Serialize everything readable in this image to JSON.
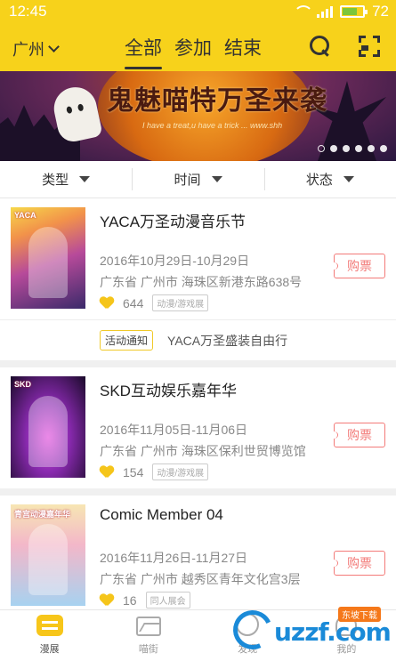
{
  "status_bar": {
    "time": "12:45",
    "battery": "72",
    "battery_level": 0.72
  },
  "header": {
    "city": "广州",
    "tabs": [
      {
        "label": "全部",
        "active": true
      },
      {
        "label": "参加",
        "active": false
      },
      {
        "label": "结束",
        "active": false
      }
    ],
    "icons": [
      "search-icon",
      "scan-icon"
    ]
  },
  "banner": {
    "title": "鬼魅喵特万圣来袭",
    "subtitle": "I have a treat,u have a trick ... www.shh",
    "slide_count": 6,
    "active_slide": 0
  },
  "filters": [
    {
      "label": "类型"
    },
    {
      "label": "时间"
    },
    {
      "label": "状态"
    }
  ],
  "events": [
    {
      "title": "YACA万圣动漫音乐节",
      "date": "2016年10月29日-10月29日",
      "address": "广东省 广州市 海珠区新港东路638号",
      "likes": "644",
      "tag": "动漫/游戏展",
      "buy_label": "购票",
      "poster_label": "YACA",
      "notice": {
        "tag": "活动通知",
        "text": "YACA万圣盛装自由行"
      }
    },
    {
      "title": "SKD互动娱乐嘉年华",
      "date": "2016年11月05日-11月06日",
      "address": "广东省 广州市 海珠区保利世贸博览馆",
      "likes": "154",
      "tag": "动漫/游戏展",
      "buy_label": "购票",
      "poster_label": "SKD"
    },
    {
      "title": "Comic Member 04",
      "date": "2016年11月26日-11月27日",
      "address": "广东省 广州市 越秀区青年文化宫3层",
      "likes": "16",
      "tag": "同人展会",
      "buy_label": "购票",
      "poster_label": "青宫动漫嘉年华"
    }
  ],
  "bottom_nav": [
    {
      "label": "漫展",
      "icon": "comic-expo-icon",
      "active": true
    },
    {
      "label": "喵街",
      "icon": "street-icon",
      "active": false
    },
    {
      "label": "发现",
      "icon": "discover-icon",
      "active": false
    },
    {
      "label": "我的",
      "icon": "profile-icon",
      "active": false
    }
  ],
  "watermark": {
    "text": "uzzf.com",
    "badge": "东坡下载"
  },
  "colors": {
    "brand_yellow": "#f7d21b",
    "buy_red": "#f37a78",
    "like_yellow": "#f5c51a"
  }
}
